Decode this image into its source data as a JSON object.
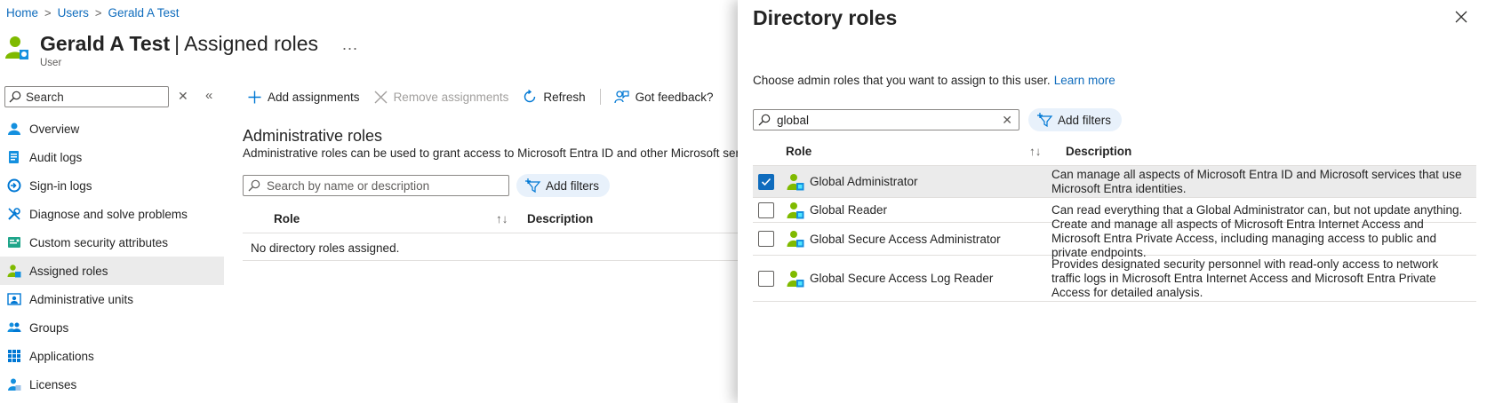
{
  "breadcrumb": [
    "Home",
    "Users",
    "Gerald A Test"
  ],
  "page": {
    "title_name": "Gerald A Test",
    "title_section": "Assigned roles",
    "subtitle": "User",
    "more": "..."
  },
  "sidebar": {
    "search_placeholder": "Search",
    "items": [
      {
        "label": "Overview",
        "icon": "user-icon"
      },
      {
        "label": "Audit logs",
        "icon": "audit-log-icon"
      },
      {
        "label": "Sign-in logs",
        "icon": "sign-in-log-icon"
      },
      {
        "label": "Diagnose and solve problems",
        "icon": "wrench-icon"
      },
      {
        "label": "Custom security attributes",
        "icon": "attribute-icon"
      },
      {
        "label": "Assigned roles",
        "icon": "assigned-roles-icon",
        "active": true
      },
      {
        "label": "Administrative units",
        "icon": "admin-units-icon"
      },
      {
        "label": "Groups",
        "icon": "groups-icon"
      },
      {
        "label": "Applications",
        "icon": "apps-grid-icon"
      },
      {
        "label": "Licenses",
        "icon": "license-icon"
      }
    ]
  },
  "toolbar": {
    "add": "Add assignments",
    "remove": "Remove assignments",
    "refresh": "Refresh",
    "feedback": "Got feedback?"
  },
  "main": {
    "section_title": "Administrative roles",
    "section_desc": "Administrative roles can be used to grant access to Microsoft Entra ID and other Microsoft serv",
    "search_placeholder": "Search by name or description",
    "add_filters": "Add filters",
    "col_role": "Role",
    "col_desc": "Description",
    "empty": "No directory roles assigned."
  },
  "panel": {
    "title": "Directory roles",
    "desc": "Choose admin roles that you want to assign to this user.",
    "learn_more": "Learn more",
    "search_value": "global",
    "add_filters": "Add filters",
    "col_role": "Role",
    "col_desc": "Description",
    "rows": [
      {
        "name": "Global Administrator",
        "desc": "Can manage all aspects of Microsoft Entra ID and Microsoft services that use Microsoft Entra identities.",
        "checked": true
      },
      {
        "name": "Global Reader",
        "desc": "Can read everything that a Global Administrator can, but not update anything.",
        "checked": false
      },
      {
        "name": "Global Secure Access Administrator",
        "desc": "Create and manage all aspects of Microsoft Entra Internet Access and Microsoft Entra Private Access, including managing access to public and private endpoints.",
        "checked": false
      },
      {
        "name": "Global Secure Access Log Reader",
        "desc": "Provides designated security personnel with read-only access to network traffic logs in Microsoft Entra Internet Access and Microsoft Entra Private Access for detailed analysis.",
        "checked": false
      }
    ]
  },
  "colors": {
    "link": "#0f6cbd",
    "selected_row": "#ebebeb",
    "pill_bg": "#e8f1fb"
  }
}
